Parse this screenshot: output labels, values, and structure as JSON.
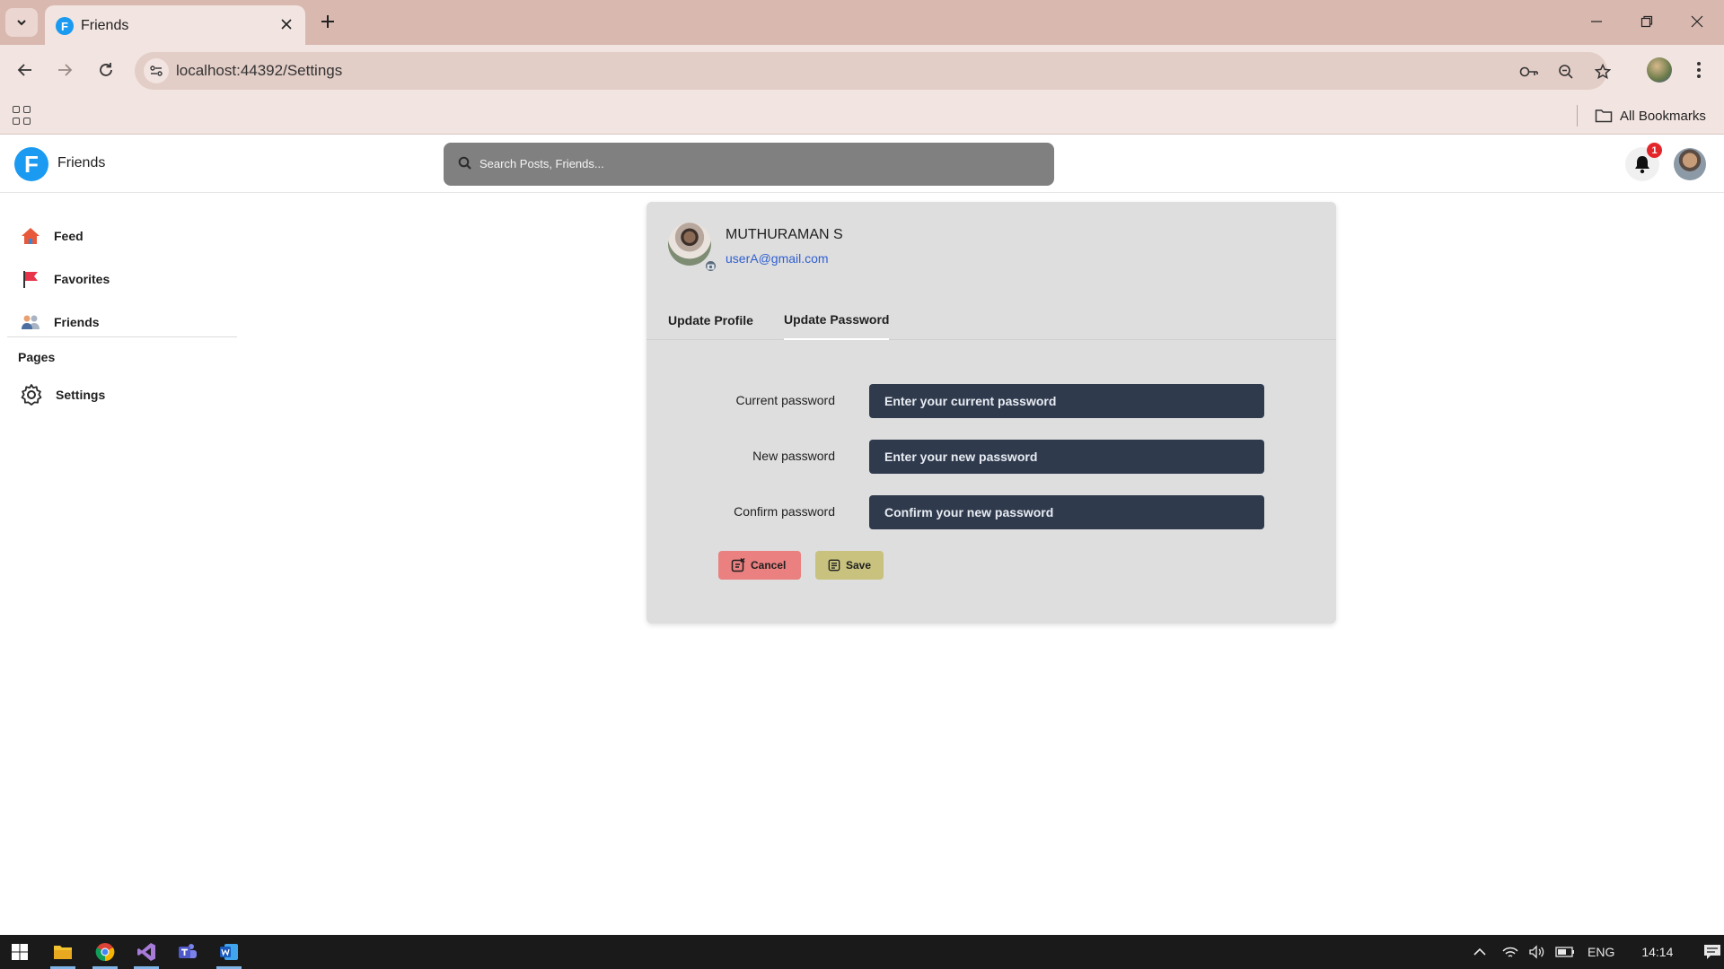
{
  "browser": {
    "tab_title": "Friends",
    "tab_favicon_letter": "F",
    "url": "localhost:44392/Settings",
    "all_bookmarks_label": "All Bookmarks",
    "colors": {
      "frame": "#d9b8b0",
      "toolbar": "#f2e4e0"
    }
  },
  "app": {
    "logo_letter": "F",
    "brand": "Friends",
    "search_placeholder": "Search Posts, Friends...",
    "notification_count": "1",
    "accent": "#1a9af0"
  },
  "sidebar": {
    "items": [
      {
        "label": "Feed",
        "icon": "home-icon"
      },
      {
        "label": "Favorites",
        "icon": "flag-icon"
      },
      {
        "label": "Friends",
        "icon": "users-icon"
      }
    ],
    "pages_heading": "Pages",
    "pages": [
      {
        "label": "Settings",
        "icon": "gear-icon"
      }
    ]
  },
  "profile": {
    "name": "MUTHURAMAN S",
    "email": "userA@gmail.com"
  },
  "tabs": [
    {
      "label": "Update Profile",
      "active": false
    },
    {
      "label": "Update Password",
      "active": true
    }
  ],
  "form": {
    "fields": [
      {
        "label": "Current password",
        "placeholder": "Enter your current password"
      },
      {
        "label": "New password",
        "placeholder": "Enter your new password"
      },
      {
        "label": "Confirm password",
        "placeholder": "Confirm your new password"
      }
    ],
    "cancel_label": "Cancel",
    "save_label": "Save",
    "colors": {
      "input_bg": "#2f3a4d",
      "cancel": "#ea8080",
      "save": "#c8c27e",
      "card": "#dedede"
    }
  },
  "taskbar": {
    "language": "ENG",
    "time": "14:14"
  }
}
